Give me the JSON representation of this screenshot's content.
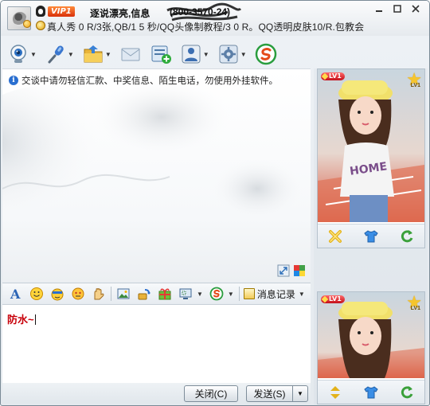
{
  "header": {
    "vip_label": "VIP1",
    "contact_name": "逐说漂亮,信息",
    "contact_id": "(800-3570-24)",
    "signature": "真人秀 0 R/3张,QB/1 5 秒/QQ头像制教程/3 0 R。QQ透明皮肤10/R.包教会",
    "window_controls": [
      "minimize-icon",
      "maximize-icon",
      "close-icon"
    ]
  },
  "toolbar": {
    "items": [
      {
        "name": "video-call",
        "icon": "webcam-icon",
        "has_menu": true
      },
      {
        "name": "voice-call",
        "icon": "microphone-icon",
        "has_menu": true
      },
      {
        "name": "send-file",
        "icon": "folder-icon",
        "has_menu": true
      },
      {
        "name": "send-sms",
        "icon": "envelope-icon",
        "has_menu": false
      },
      {
        "name": "create-group",
        "icon": "add-group-icon",
        "has_menu": false
      },
      {
        "name": "remote-assist",
        "icon": "person-app-icon",
        "has_menu": true
      },
      {
        "name": "apps",
        "icon": "gear-app-icon",
        "has_menu": true
      },
      {
        "name": "soso",
        "icon": "soso-icon",
        "has_menu": false
      }
    ]
  },
  "chat": {
    "notice_icon": "info-icon",
    "notice": "交谈中请勿轻信汇款、中奖信息、陌生电话，勿使用外挂软件。",
    "corner_icons": [
      "expand-icon",
      "color-palette-icon"
    ]
  },
  "format_bar": {
    "tools": [
      {
        "name": "font",
        "icon": "font-icon"
      },
      {
        "name": "emoticon",
        "icon": "smiley-icon"
      },
      {
        "name": "magic-emoticon",
        "icon": "magic-face-icon"
      },
      {
        "name": "nudge",
        "icon": "shake-icon"
      },
      {
        "name": "scribble",
        "icon": "hand-draw-icon"
      },
      {
        "name": "image",
        "icon": "picture-icon"
      },
      {
        "name": "music",
        "icon": "music-icon"
      },
      {
        "name": "gift",
        "icon": "gift-icon"
      },
      {
        "name": "screenshot",
        "icon": "screenshot-icon"
      },
      {
        "name": "soso-search",
        "icon": "soso-icon"
      }
    ],
    "history_label": "消息记录"
  },
  "input": {
    "text": "防水~"
  },
  "buttons": {
    "close_label": "关闭(C)",
    "send_label": "发送(S)"
  },
  "show_panel": {
    "level_label": "LV1",
    "star_level": "LV1",
    "actions_top": [
      "x-icon",
      "tshirt-icon",
      "refresh-icon"
    ],
    "actions_bottom": [
      "arrows-icon",
      "tshirt-icon",
      "refresh-icon"
    ]
  },
  "colors": {
    "typed_text": "#c8000a",
    "vip_badge": "#e0400c",
    "accent_blue": "#2a6fd0"
  }
}
